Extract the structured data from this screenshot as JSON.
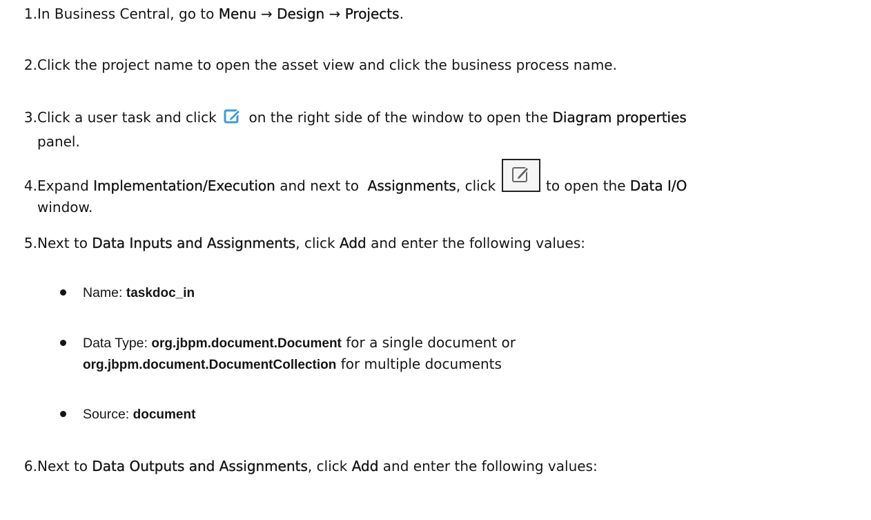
{
  "steps": [
    {
      "num": "1.",
      "parts": [
        "In Business Central, go to ",
        "Menu",
        " → ",
        "Design",
        " → ",
        "Projects",
        "."
      ]
    },
    {
      "num": "2.",
      "text": "Click the project name to open the asset view and click the business process name."
    },
    {
      "num": "3.",
      "a": "Click a user task and click ",
      "b": " on the right side of the window to open the ",
      "c": "Diagram properties",
      "d": "panel.",
      "icon": "edit-diagram-properties-icon"
    },
    {
      "num": "4.",
      "a": "Expand ",
      "b": "Implementation/Execution",
      "c": " and next to  ",
      "d": "Assignments",
      "e": ", click ",
      "f": " to open the ",
      "g": "Data I/O",
      "h": "window.",
      "icon": "edit-assignments-icon"
    },
    {
      "num": "5.",
      "a": "Next to ",
      "b": "Data Inputs and Assignments",
      "c": ", click ",
      "d": "Add",
      "e": " and enter the following values:"
    },
    {
      "num": "6.",
      "a": "Next to ",
      "b": "Data Outputs and Assignments",
      "c": ", click ",
      "d": "Add",
      "e": " and enter the following values:"
    }
  ],
  "bullets": [
    {
      "label": "Name",
      "sep": ": ",
      "value": "taskdoc_in"
    },
    {
      "label": "Data Type",
      "sep": ": ",
      "value": "org.jbpm.document.Document",
      "mid": " for a single document or",
      "value2": "org.jbpm.document.DocumentCollection",
      "tail": " for multiple documents"
    },
    {
      "label": "Source",
      "sep": ": ",
      "value": "document"
    }
  ],
  "colors": {
    "text": "#151515",
    "icon_blue": "#3c9ad6"
  }
}
